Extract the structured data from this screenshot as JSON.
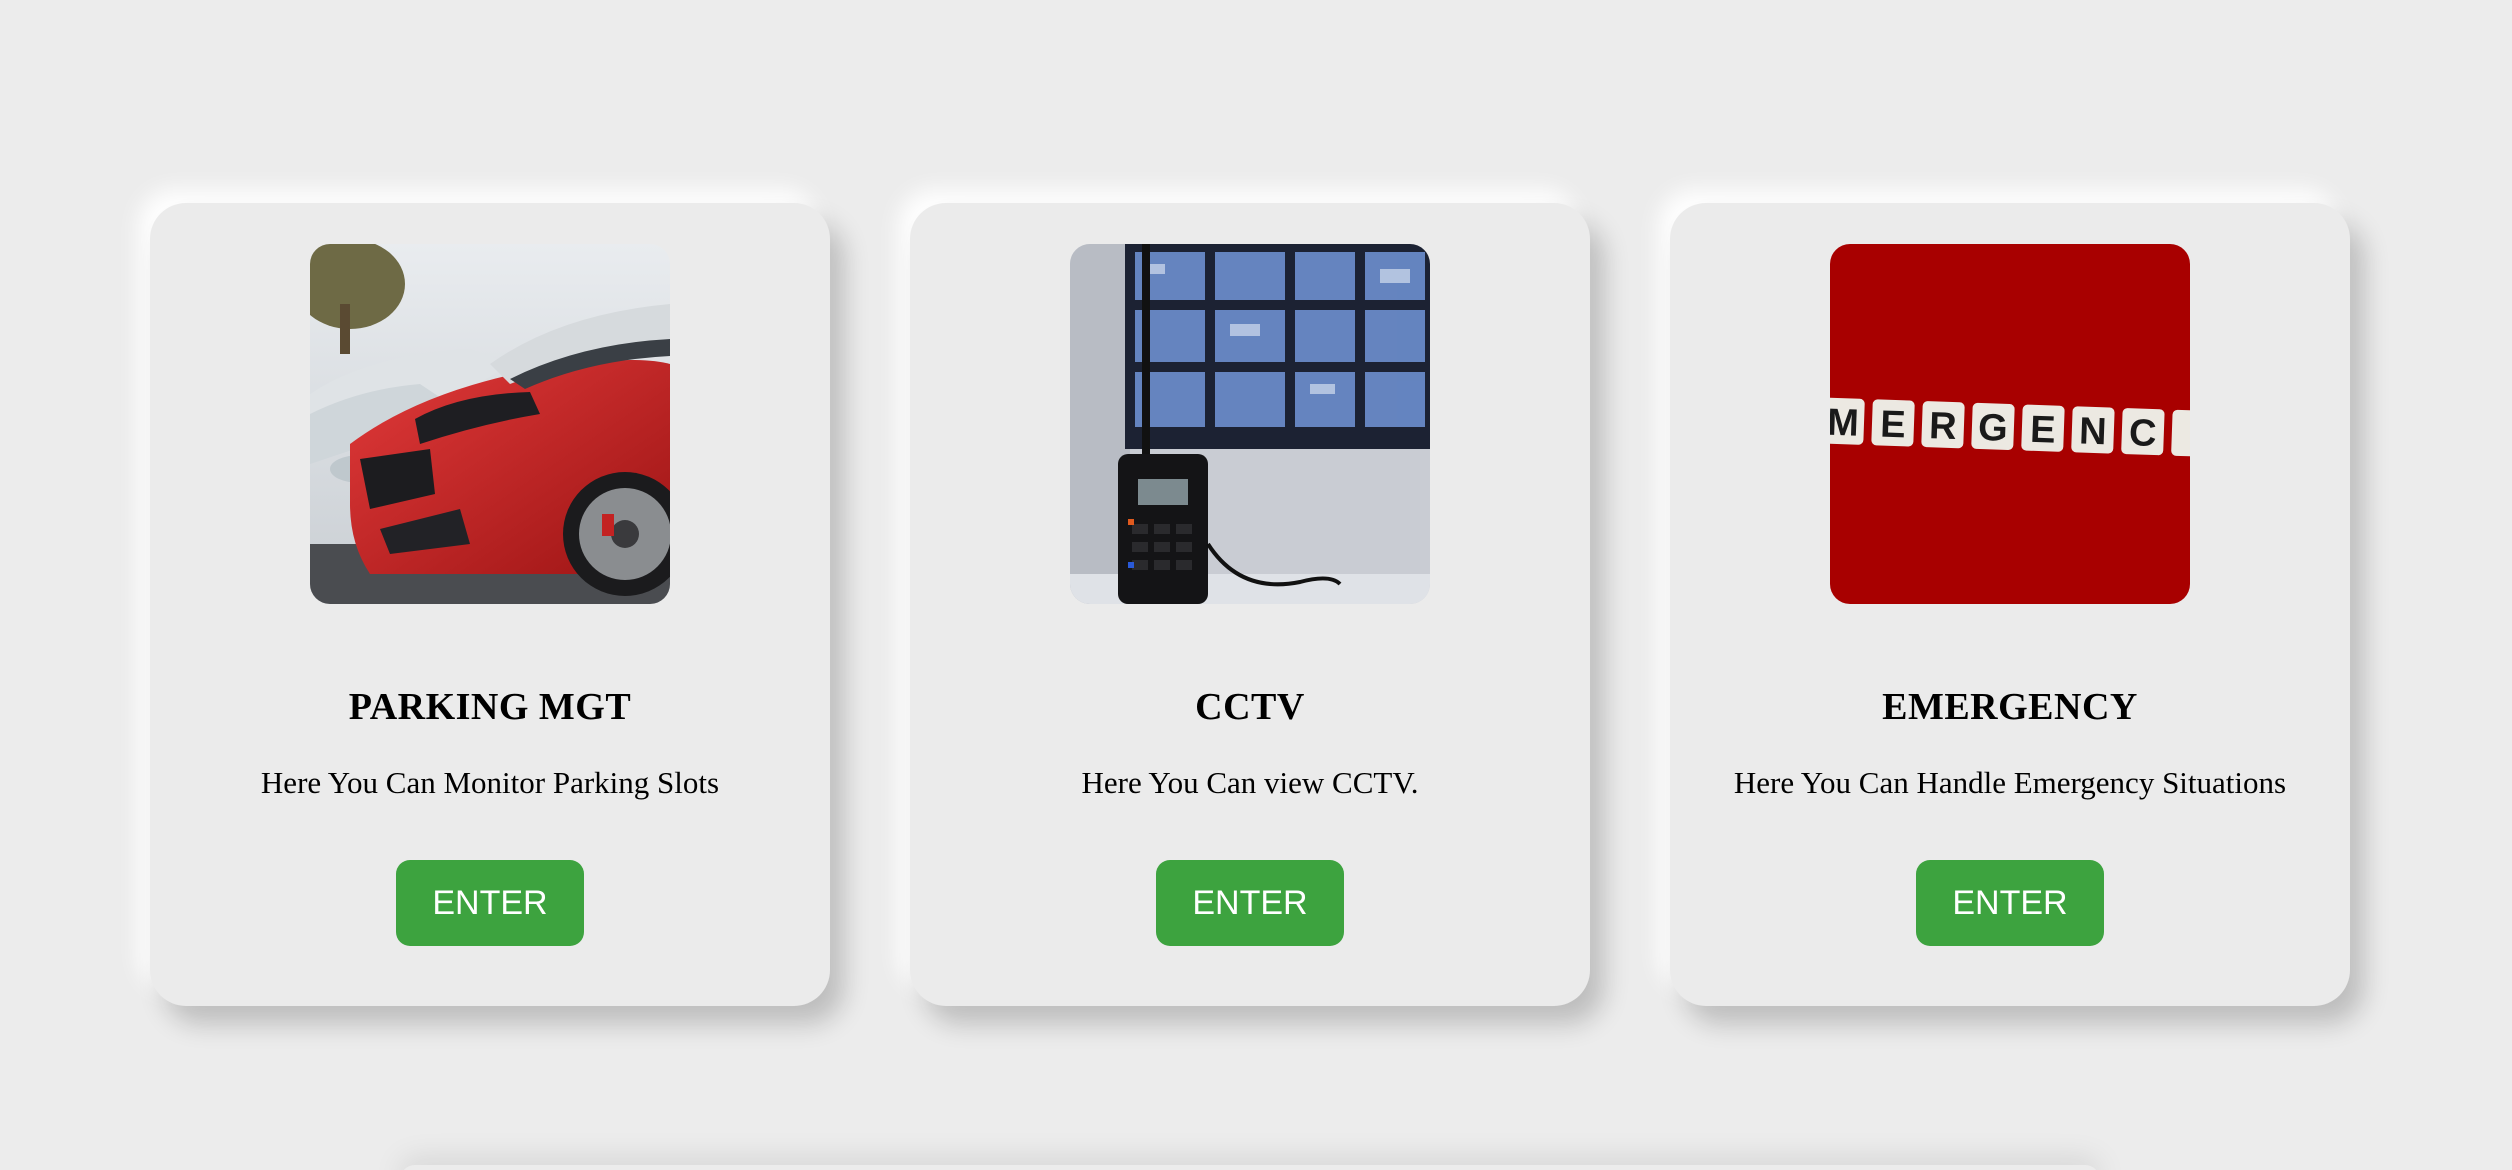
{
  "cards": [
    {
      "image": "red-car-parking-photo",
      "title": "PARKING MGT",
      "description": "Here You Can Monitor Parking Slots",
      "button_label": "ENTER"
    },
    {
      "image": "walkie-talkie-cctv-monitors-photo",
      "title": "CCTV",
      "description": "Here You Can view CCTV.",
      "button_label": "ENTER"
    },
    {
      "image": "emergency-letter-tiles-photo",
      "image_text": "EMERGENCY",
      "title": "EMERGENCY",
      "description": "Here You Can Handle Emergency Situations",
      "button_label": "ENTER"
    }
  ],
  "colors": {
    "background": "#ececec",
    "card": "#ebebeb",
    "button": "#3da33f",
    "button_text": "#ffffff",
    "emergency_red": "#a80000"
  }
}
